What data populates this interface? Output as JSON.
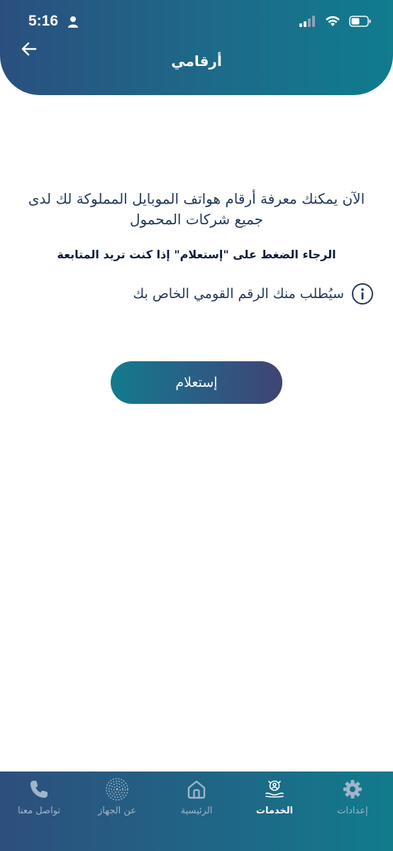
{
  "status_bar": {
    "time": "5:16"
  },
  "header": {
    "title": "أرقامي"
  },
  "content": {
    "intro_text": "الآن يمكنك معرفة أرقام هواتف الموبايل المملوكة لك لدى جميع شركات المحمول",
    "instruction_text": "الرجاء الضغط على \"إستعلام\" إذا كنت تريد المتابعة",
    "info_text": "سيُطلب منك الرقم القومي الخاص بك",
    "inquiry_button_label": "إستعلام"
  },
  "tabbar": {
    "tabs": [
      {
        "label": "إعدادات",
        "icon": "gear-icon",
        "active": false
      },
      {
        "label": "الخدمات",
        "icon": "services-icon",
        "active": true
      },
      {
        "label": "الرئيسية",
        "icon": "home-icon",
        "active": false
      },
      {
        "label": "عن الجهاز",
        "icon": "fingerprint-icon",
        "active": false
      },
      {
        "label": "تواصل معنا",
        "icon": "phone-icon",
        "active": false
      }
    ]
  },
  "colors": {
    "header_gradient_start": "#2a4f7f",
    "header_gradient_end": "#107c8e",
    "text_primary": "#24385a",
    "tab_inactive": "#9fb5c9",
    "tab_active": "#ffffff"
  }
}
